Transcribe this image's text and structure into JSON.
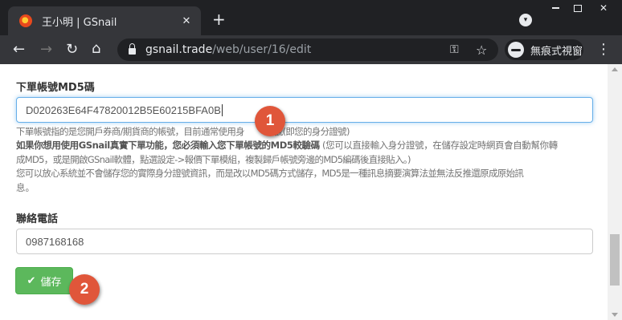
{
  "browser": {
    "tab_title": "王小明 | GSnail",
    "tab_close": "✕",
    "new_tab": "+",
    "url_host": "gsnail.trade",
    "url_path": "/web/user/16/edit",
    "incognito_label": "無痕式視窗",
    "window_close": "✕"
  },
  "form": {
    "md5_label": "下單帳號MD5碼",
    "md5_value": "D020263E64F47820012B5E60215BFA0B",
    "help": {
      "line1": "下單帳號指的是您開戶券商/期貨商的帳號，目前通常使用身",
      "line1_rest": "帳號(即您的身分證號)",
      "line2_bold_a": "如果你想用使用GSnail真實下單功能，您必須輸入您下單帳號的MD5較驗碼",
      "line2_normal": " (您可以直接輸入身分證號，在儲存設定時網頁會自動幫你轉",
      "line3": "成MD5，或是開啟GSnail軟體，點選設定->報價下單模組，複製歸戶帳號旁邊的MD5編碼後直接貼入。)",
      "line4": "您可以放心系統並不會儲存您的實際身分證號資訊，而是改以MD5碼方式儲存，MD5是一種訊息摘要演算法並無法反推還原成原始訊",
      "line5": "息。"
    },
    "phone_label": "聯絡電話",
    "phone_value": "0987168168",
    "save_label": "儲存"
  },
  "badges": {
    "one": "1",
    "two": "2"
  },
  "colors": {
    "save_button": "#5cb85c",
    "badge": "#e0563a",
    "focus_border": "#66afe9"
  }
}
